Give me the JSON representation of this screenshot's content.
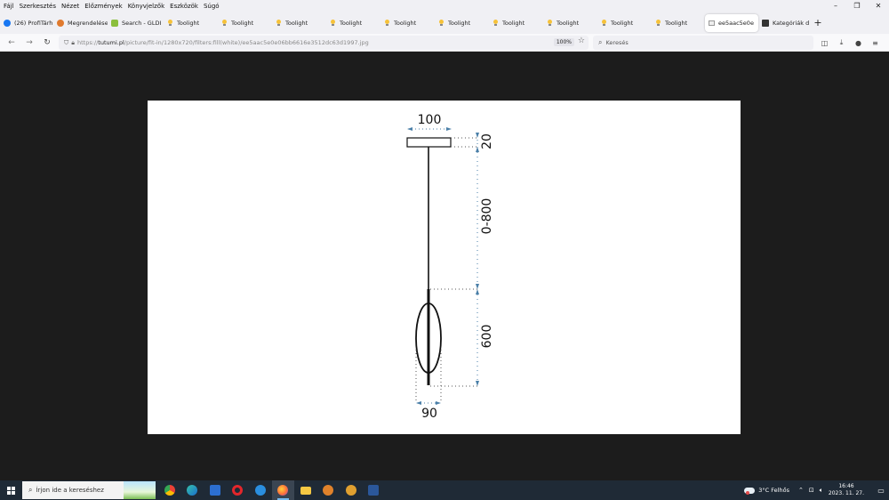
{
  "menubar": {
    "items": [
      "Fájl",
      "Szerkesztés",
      "Nézet",
      "Előzmények",
      "Könyvjelzők",
      "Eszközök",
      "Súgó"
    ],
    "window_controls": [
      "–",
      "❐",
      "✕"
    ]
  },
  "tabs": [
    {
      "label": "(26) ProfiTárh",
      "icon": "facebook-icon",
      "color": "#1877f2"
    },
    {
      "label": "Megrendelése",
      "icon": "shop-icon",
      "color": "#e07a2e"
    },
    {
      "label": "Search - GLDI",
      "icon": "search-site-icon",
      "color": "#8bbf3d"
    },
    {
      "label": "Toolight",
      "icon": "bulb-icon"
    },
    {
      "label": "Toolight",
      "icon": "bulb-icon"
    },
    {
      "label": "Toolight",
      "icon": "bulb-icon"
    },
    {
      "label": "Toolight",
      "icon": "bulb-icon"
    },
    {
      "label": "Toolight",
      "icon": "bulb-icon"
    },
    {
      "label": "Toolight",
      "icon": "bulb-icon"
    },
    {
      "label": "Toolight",
      "icon": "bulb-icon"
    },
    {
      "label": "Toolight",
      "icon": "bulb-icon"
    },
    {
      "label": "Toolight",
      "icon": "bulb-icon"
    },
    {
      "label": "Toolight",
      "icon": "bulb-icon"
    },
    {
      "label": "ee5aac5e0e",
      "icon": "image-icon",
      "active": true
    },
    {
      "label": "Kategóriák d",
      "icon": "u-icon",
      "color": "#333333"
    }
  ],
  "new_tab": "+",
  "navbar": {
    "url_prefix": "https://",
    "url_host": "tutumi.pl",
    "url_path": "/picture/fit-in/1280x720/filters:fill(white)/ee5aac5e0e06bb6616e3512dc63d1997.jpg",
    "zoom": "100%",
    "search_placeholder": "Keresés"
  },
  "drawing": {
    "dim_top_width": "100",
    "dim_canopy_height": "20",
    "dim_cable": "0-800",
    "dim_shade_height": "600",
    "dim_bottom_width": "90"
  },
  "taskbar": {
    "search_placeholder": "Írjon ide a kereséshez",
    "apps": [
      {
        "name": "chrome-icon",
        "color": "#e94235"
      },
      {
        "name": "edge-icon",
        "color": "#1a9b8e"
      },
      {
        "name": "save-icon",
        "color": "#2c6fd1"
      },
      {
        "name": "opera-icon",
        "color": "#e3262b"
      },
      {
        "name": "app-blue-icon",
        "color": "#2a8fe0"
      },
      {
        "name": "firefox-icon",
        "color": "#ff7139",
        "active": true
      },
      {
        "name": "file-explorer-icon",
        "color": "#f5c843"
      },
      {
        "name": "app-orange-icon",
        "color": "#e0822b"
      },
      {
        "name": "app-crab-icon",
        "color": "#e0a030"
      },
      {
        "name": "word-icon",
        "color": "#2b579a"
      }
    ],
    "weather_temp": "3°C",
    "weather_text": "Felhős",
    "time": "16:46",
    "date": "2023. 11. 27."
  }
}
